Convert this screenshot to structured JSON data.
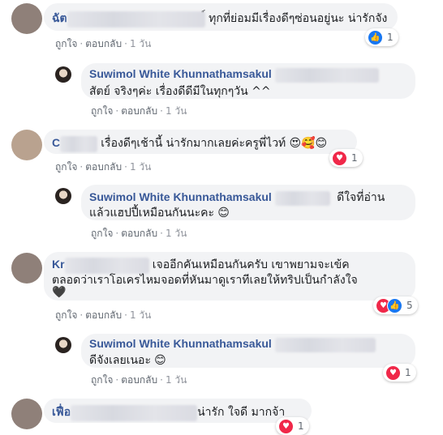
{
  "actions": {
    "like": "ถูกใจ",
    "reply": "ตอบกลับ",
    "time": "1 วัน",
    "sep": "·"
  },
  "colors": {
    "name": "#385898",
    "bubble": "#f2f3f5",
    "like": "#1877f2",
    "love": "#f02849"
  },
  "comments": [
    {
      "name_partial": "ฉัต",
      "text": "์ ทุกที่ย่อมมีเรื่องดีๆซ่อนอยู่นะ น่ารักจัง",
      "reactions": {
        "icons": [
          "like-icon"
        ],
        "count": "1"
      }
    },
    {
      "name": "Suwimol White Khunnathamsakul",
      "text": "สัตย์ จริงๆค่ะ เรื่องดีดีมีในทุกๆวัน ^^",
      "reply": true
    },
    {
      "name_partial": "C",
      "text": "เรื่องดีๆเช้านี้ น่ารักมากเลยค่ะครูพี่ไวท์",
      "emojis": "😍🥰😊",
      "reactions": {
        "icons": [
          "love-icon"
        ],
        "count": "1"
      }
    },
    {
      "name": "Suwimol White Khunnathamsakul",
      "text_line1": "ดีใจที่อ่าน",
      "text_line2": "แล้วแฮปปี้เหมือนกันนะคะ",
      "emojis": "😊",
      "reply": true
    },
    {
      "name_partial": "Kr",
      "text_line1": "เจออีกคันเหมือนกันครับ เขาพยามจะเข้ค",
      "text_line2": "ตลอดว่าเราโอเครไหมจอดที่หันมาดูเราทีเลยให้ทริปเป็นกำลังใจ",
      "emojis": "🖤",
      "reactions": {
        "icons": [
          "love-icon",
          "like-icon"
        ],
        "count": "5"
      }
    },
    {
      "name": "Suwimol White Khunnathamsakul",
      "text": "ดีจังเลยเนอะ",
      "emojis": "😊",
      "reply": true,
      "reactions": {
        "icons": [
          "love-icon"
        ],
        "count": "1"
      }
    },
    {
      "name_partial": "เฟื่อ",
      "text": "น่ารัก ใจดี มากจ้า",
      "reactions": {
        "icons": [
          "love-icon"
        ],
        "count": "1"
      }
    }
  ]
}
